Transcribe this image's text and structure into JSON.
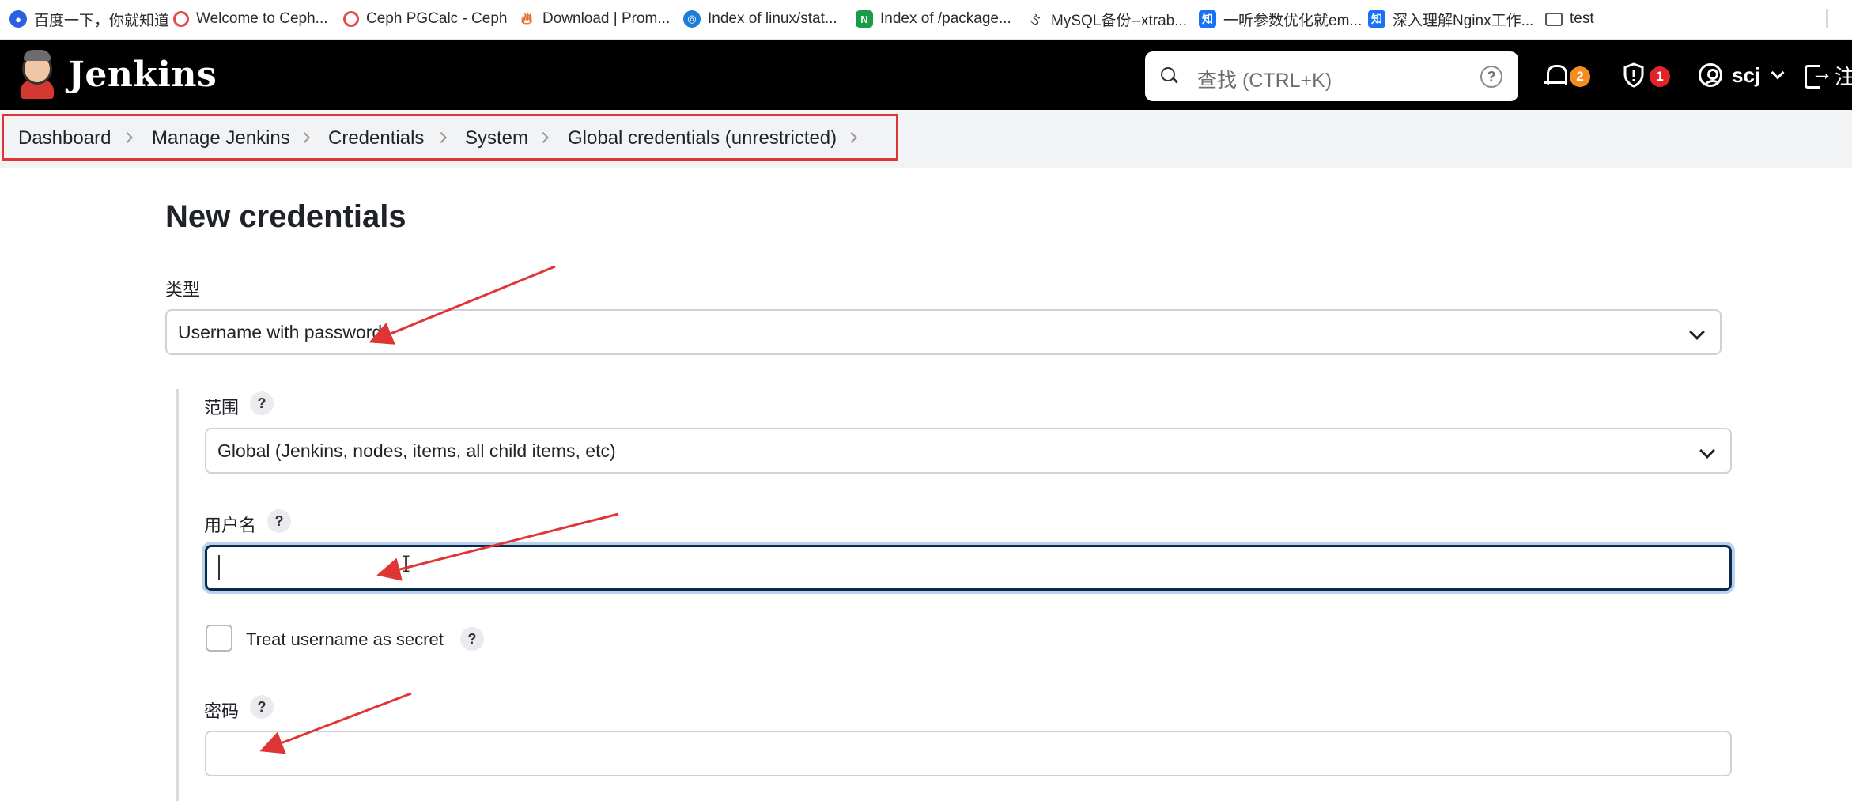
{
  "bookmarks": [
    {
      "label": "百度一下，你就知道",
      "icon": "baidu-icon"
    },
    {
      "label": "Welcome to Ceph...",
      "icon": "ceph-icon"
    },
    {
      "label": "Ceph PGCalc - Ceph",
      "icon": "ceph-icon"
    },
    {
      "label": "Download | Prom...",
      "icon": "prometheus-icon"
    },
    {
      "label": "Index of linux/stat...",
      "icon": "globe-icon"
    },
    {
      "label": "Index of /package...",
      "icon": "nginx-icon"
    },
    {
      "label": "MySQL备份--xtrab...",
      "icon": "mysql-icon"
    },
    {
      "label": "一听参数优化就em...",
      "icon": "zhihu-icon"
    },
    {
      "label": "深入理解Nginx工作...",
      "icon": "zhihu-icon"
    },
    {
      "label": "test",
      "icon": "folder-icon"
    }
  ],
  "header": {
    "brand": "Jenkins",
    "search_placeholder": "查找 (CTRL+K)",
    "notifications_count": "2",
    "security_count": "1",
    "user": "scj",
    "logout_label": "注"
  },
  "breadcrumb": [
    "Dashboard",
    "Manage Jenkins",
    "Credentials",
    "System",
    "Global credentials (unrestricted)"
  ],
  "form": {
    "title": "New credentials",
    "kind_label": "类型",
    "kind_value": "Username with password",
    "scope_label": "范围",
    "scope_value": "Global (Jenkins, nodes, items, all child items, etc)",
    "username_label": "用户名",
    "username_value": "",
    "treat_secret_label": "Treat username as secret",
    "password_label": "密码",
    "password_value": "",
    "help_mark": "?"
  },
  "colors": {
    "header_bg": "#000000",
    "annotation_red": "#e03535",
    "focus_ring": "#b5d3ef"
  }
}
